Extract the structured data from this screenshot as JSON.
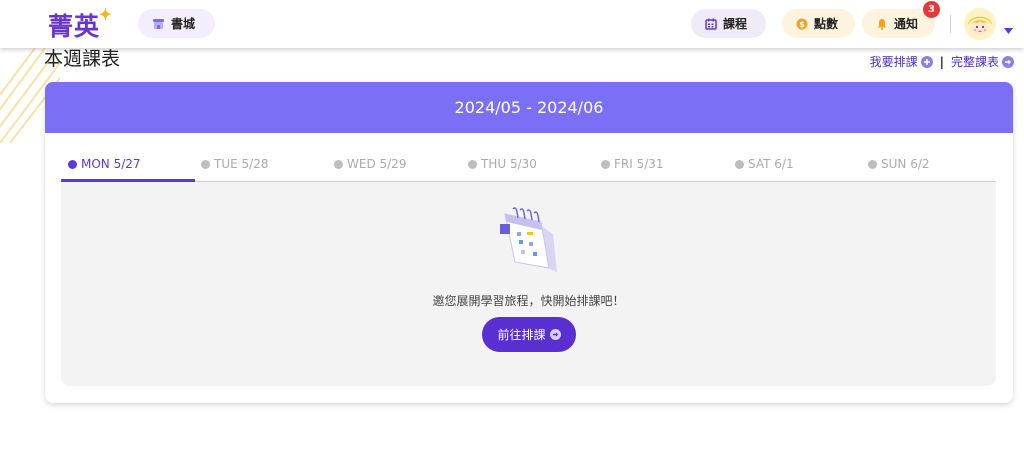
{
  "header": {
    "logo_text": "菁英",
    "store_label": "書城",
    "course_label": "課程",
    "points_label": "點數",
    "notify_label": "通知",
    "notify_count": "3"
  },
  "page": {
    "title": "本週課表",
    "link_schedule": "我要排課",
    "link_separator": "|",
    "link_full": "完整課表"
  },
  "card": {
    "range": "2024/05 - 2024/06",
    "tabs": [
      {
        "label": "MON 5/27"
      },
      {
        "label": "TUE 5/28"
      },
      {
        "label": "WED 5/29"
      },
      {
        "label": "THU 5/30"
      },
      {
        "label": "FRI 5/31"
      },
      {
        "label": "SAT 6/1"
      },
      {
        "label": "SUN 6/2"
      }
    ],
    "empty_message": "邀您展開學習旅程，快開始排課吧！",
    "cta_label": "前往排課"
  },
  "colors": {
    "brand": "#6a35c9",
    "card_header": "#7a6ff5",
    "active_tab": "#5a39d6",
    "cta": "#5a2fd0",
    "badge": "#e5383b"
  },
  "icons": {
    "store": "storefront-icon",
    "course": "calendar-icon",
    "points": "coin-icon",
    "notify": "bell-icon",
    "avatar": "avatar-icon",
    "dropdown": "caret-down-icon",
    "plus": "plus-circle-icon",
    "arrow": "arrow-right-circle-icon",
    "empty": "calendar-illustration-icon"
  }
}
